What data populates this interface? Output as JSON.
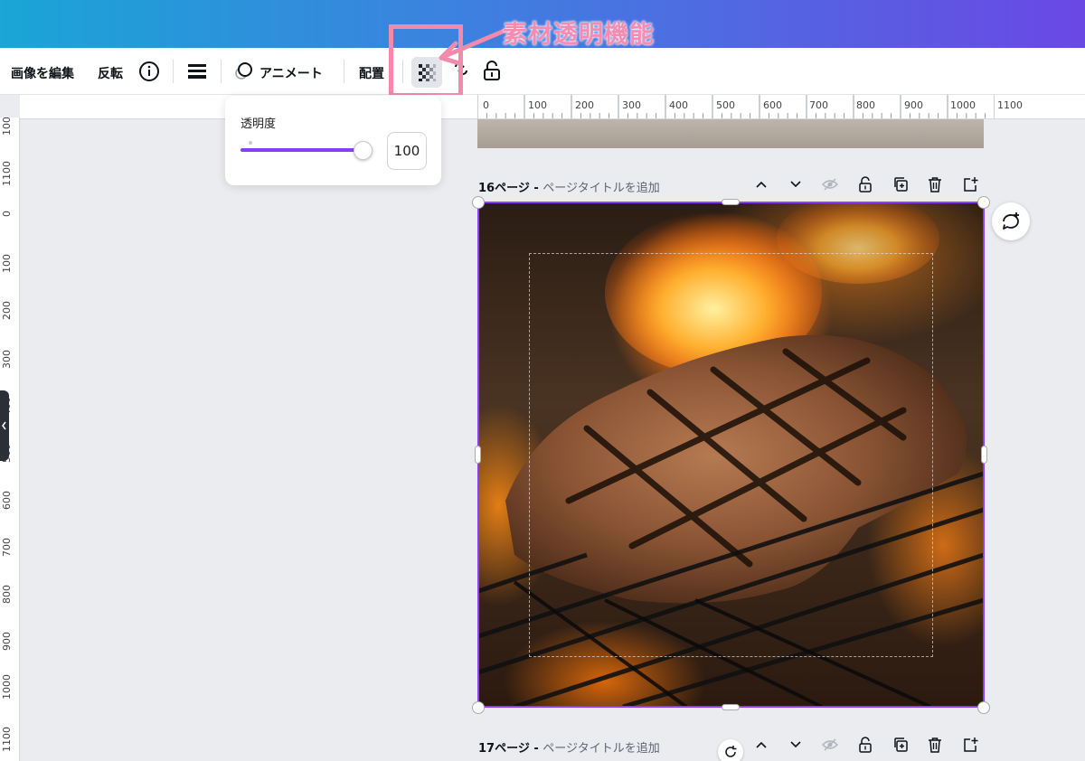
{
  "annotation": {
    "label": "素材透明機能"
  },
  "toolbar": {
    "edit_image": "画像を編集",
    "flip": "反転",
    "animate": "アニメート",
    "position": "配置",
    "icons": [
      "info-icon",
      "border-style-icon",
      "animate-icon",
      "transparency-icon",
      "link-icon",
      "lock-icon"
    ]
  },
  "transparency_popover": {
    "title": "透明度",
    "value": "100",
    "slider_fraction": 1.0
  },
  "rulers": {
    "top": [
      "0",
      "100",
      "200",
      "300",
      "400",
      "500",
      "600",
      "700",
      "800",
      "900",
      "1000",
      "1100"
    ],
    "left": [
      "100",
      "1100",
      "0",
      "100",
      "200",
      "300",
      "400",
      "500",
      "600",
      "700",
      "800",
      "900",
      "1000",
      "1100"
    ]
  },
  "pages": [
    {
      "number": "16ページ",
      "separator": " - ",
      "placeholder": "ページタイトルを追加"
    },
    {
      "number": "17ページ",
      "separator": " - ",
      "placeholder": "ページタイトルを追加"
    }
  ],
  "colors": {
    "accent": "#8b3dff",
    "annotation": "#f28bab"
  }
}
